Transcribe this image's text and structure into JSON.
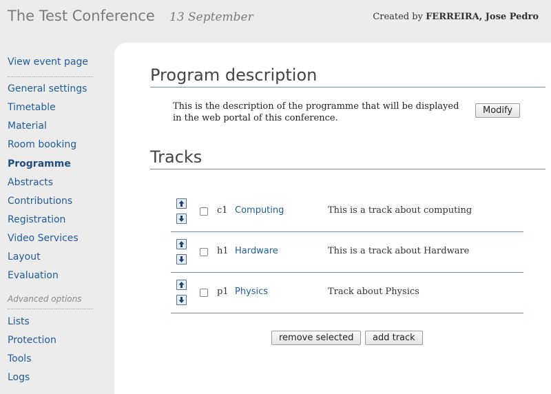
{
  "header": {
    "title": "The Test Conference",
    "date": "13 September",
    "created_prefix": "Created by",
    "creator": "FERREIRA, Jose Pedro"
  },
  "sidebar": {
    "view_event": "View event page",
    "items": [
      {
        "label": "General settings"
      },
      {
        "label": "Timetable"
      },
      {
        "label": "Material"
      },
      {
        "label": "Room booking"
      },
      {
        "label": "Programme",
        "active": true
      },
      {
        "label": "Abstracts"
      },
      {
        "label": "Contributions"
      },
      {
        "label": "Registration"
      },
      {
        "label": "Video Services"
      },
      {
        "label": "Layout"
      },
      {
        "label": "Evaluation"
      }
    ],
    "advanced_heading": "Advanced options",
    "advanced_items": [
      {
        "label": "Lists"
      },
      {
        "label": "Protection"
      },
      {
        "label": "Tools"
      },
      {
        "label": "Logs"
      }
    ]
  },
  "program": {
    "title": "Program description",
    "description": "This is the description of the programme that will be displayed in the web portal of this conference.",
    "modify_label": "Modify"
  },
  "tracks": {
    "title": "Tracks",
    "rows": [
      {
        "code": "c1",
        "name": "Computing",
        "description": "This is a track about computing"
      },
      {
        "code": "h1",
        "name": "Hardware",
        "description": "This is a track about Hardware"
      },
      {
        "code": "p1",
        "name": "Physics",
        "description": "Track about Physics"
      }
    ],
    "remove_label": "remove selected",
    "add_label": "add track"
  },
  "colors": {
    "link": "#1f5c99",
    "sidebar_bg": "#ececec",
    "rule": "#6c8bab"
  }
}
